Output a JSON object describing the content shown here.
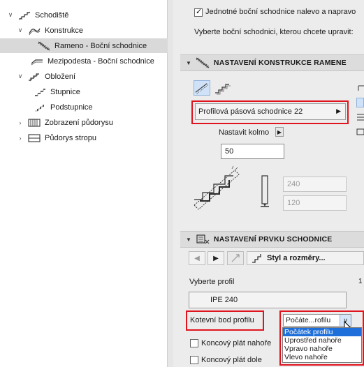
{
  "tree": {
    "items": [
      {
        "label": "Schodiště",
        "expanded": true,
        "icon": "stair-icon"
      },
      {
        "label": "Konstrukce",
        "expanded": true,
        "icon": "structure-icon"
      },
      {
        "label": "Rameno - Boční schodnice",
        "selected": true,
        "icon": "side-stringer-icon"
      },
      {
        "label": "Mezipodesta - Boční schodnice",
        "icon": "landing-stringer-icon"
      },
      {
        "label": "Obložení",
        "expanded": true,
        "icon": "finish-icon"
      },
      {
        "label": "Stupnice",
        "icon": "tread-icon"
      },
      {
        "label": "Podstupnice",
        "icon": "riser-icon"
      },
      {
        "label": "Zobrazení půdorysu",
        "expanded": false,
        "icon": "floor-plan-icon"
      },
      {
        "label": "Půdorys stropu",
        "expanded": false,
        "icon": "ceiling-plan-icon"
      }
    ]
  },
  "top": {
    "uniform_label": "Jednotné boční schodnice nalevo a napravo",
    "uniform_checked": true,
    "select_hint": "Vyberte boční schodnici, kterou chcete upravit:"
  },
  "section1": {
    "title": "NASTAVENÍ KONSTRUKCE RAMENE",
    "profile_type": "Profilová pásová schodnice 22",
    "perpendicular_label": "Nastavit kolmo",
    "offset_value": "50",
    "height_value": "240",
    "width_value": "120"
  },
  "section2": {
    "title": "NASTAVENÍ PRVKU SCHODNICE",
    "style_button": "Styl a rozměry...",
    "select_profile_label": "Vyberte profil",
    "profile_value": "IPE 240",
    "anchor_label": "Kotevní bod profilu",
    "anchor_selected": "Počáte...rofilu",
    "anchor_options": [
      "Počátek profilu",
      "Uprostřed nahoře",
      "Vpravo nahoře",
      "Vlevo nahoře"
    ],
    "end_plate_top": "Koncový plát nahoře",
    "end_plate_bottom": "Koncový plát dole"
  },
  "colors": {
    "highlight": "#e0141e",
    "selection": "#1e6fd9",
    "tree_selected": "#d9d9d9"
  }
}
